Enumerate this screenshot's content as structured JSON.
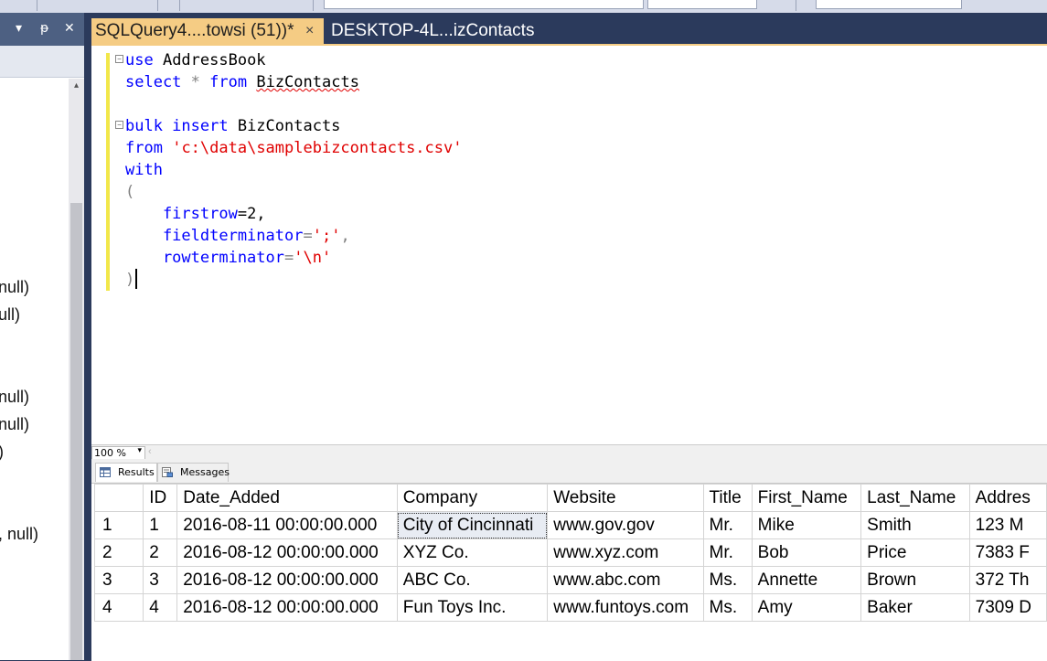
{
  "tabs": {
    "active": {
      "label": "SQLQuery4....towsi (51))*",
      "close": "×"
    },
    "inactive": {
      "label": "DESKTOP-4L...izContacts"
    }
  },
  "left_panel": {
    "controls": {
      "dropdown": "▾",
      "pin": "ᵽ",
      "close": "✕"
    },
    "scroll_up": "▴",
    "lines": [
      "null)",
      "ull)",
      "null)",
      "null)",
      ")",
      ", null)"
    ]
  },
  "editor": {
    "lines": [
      {
        "parts": [
          {
            "t": "use",
            "c": "kw"
          },
          {
            "t": " AddressBook",
            "c": "id"
          }
        ]
      },
      {
        "parts": [
          {
            "t": "select",
            "c": "kw"
          },
          {
            "t": " * ",
            "c": "op"
          },
          {
            "t": "from",
            "c": "kw"
          },
          {
            "t": " ",
            "c": "id"
          },
          {
            "t": "BizContacts",
            "c": "sq"
          }
        ]
      },
      {
        "parts": []
      },
      {
        "parts": [
          {
            "t": "bulk insert",
            "c": "kw"
          },
          {
            "t": " BizContacts",
            "c": "id"
          }
        ]
      },
      {
        "parts": [
          {
            "t": "from",
            "c": "kw"
          },
          {
            "t": " ",
            "c": "id"
          },
          {
            "t": "'c:\\data\\samplebizcontacts.csv'",
            "c": "str"
          }
        ]
      },
      {
        "parts": [
          {
            "t": "with",
            "c": "kw"
          }
        ]
      },
      {
        "parts": [
          {
            "t": "(",
            "c": "op"
          }
        ]
      },
      {
        "parts": [
          {
            "t": "    firstrow",
            "c": "kw"
          },
          {
            "t": "=2,",
            "c": "id"
          }
        ]
      },
      {
        "parts": [
          {
            "t": "    fieldterminator",
            "c": "kw"
          },
          {
            "t": "=",
            "c": "op"
          },
          {
            "t": "';'",
            "c": "str"
          },
          {
            "t": ",",
            "c": "op"
          }
        ]
      },
      {
        "parts": [
          {
            "t": "    rowterminator",
            "c": "kw"
          },
          {
            "t": "=",
            "c": "op"
          },
          {
            "t": "'\\n'",
            "c": "str"
          }
        ]
      },
      {
        "parts": [
          {
            "t": ")",
            "c": "op"
          }
        ]
      }
    ]
  },
  "zoom": {
    "value": "100 %",
    "arrow": "▾",
    "scroll_left": "‹"
  },
  "result_tabs": {
    "results": "Results",
    "messages": "Messages"
  },
  "grid": {
    "columns": [
      "",
      "ID",
      "Date_Added",
      "Company",
      "Website",
      "Title",
      "First_Name",
      "Last_Name",
      "Addres"
    ],
    "rows": [
      [
        "1",
        "1",
        "2016-08-11 00:00:00.000",
        "City of Cincinnati",
        "www.gov.gov",
        "Mr.",
        "Mike",
        "Smith",
        "123 M"
      ],
      [
        "2",
        "2",
        "2016-08-12 00:00:00.000",
        "XYZ Co.",
        "www.xyz.com",
        "Mr.",
        "Bob",
        "Price",
        "7383 F"
      ],
      [
        "3",
        "3",
        "2016-08-12 00:00:00.000",
        "ABC Co.",
        "www.abc.com",
        "Ms.",
        "Annette",
        "Brown",
        "372 Th"
      ],
      [
        "4",
        "4",
        "2016-08-12 00:00:00.000",
        "Fun Toys Inc.",
        "www.funtoys.com",
        "Ms.",
        "Amy",
        "Baker",
        "7309 D"
      ]
    ]
  },
  "colors": {
    "active_tab": "#f5cc84",
    "chrome": "#2b3a5c",
    "keyword": "#0000ff",
    "string": "#e00000"
  }
}
